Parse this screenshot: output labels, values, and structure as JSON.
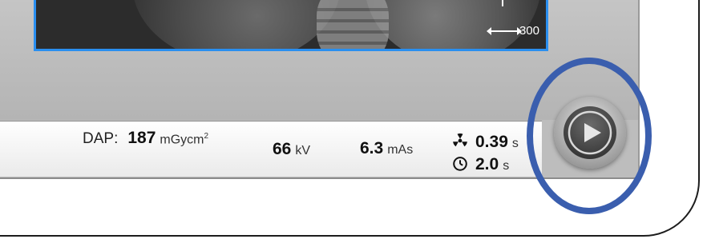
{
  "preview": {
    "scale_label": "300"
  },
  "parameters": {
    "dap_label": "DAP:",
    "dap_value": "187",
    "dap_unit": "mGycm",
    "dap_unit_sup": "2",
    "kv_value": "66",
    "kv_unit": "kV",
    "mas_value": "6.3",
    "mas_unit": "mAs",
    "exposure_time_value": "0.39",
    "exposure_time_unit": "s",
    "time_value": "2.0",
    "time_unit": "s"
  },
  "icons": {
    "exposure": "radiation-icon",
    "timer": "stopwatch-icon",
    "start": "play-icon"
  },
  "colors": {
    "highlight_ring": "#3a5eae",
    "preview_border": "#2a8ff0",
    "screen": "#bdbdbd"
  }
}
